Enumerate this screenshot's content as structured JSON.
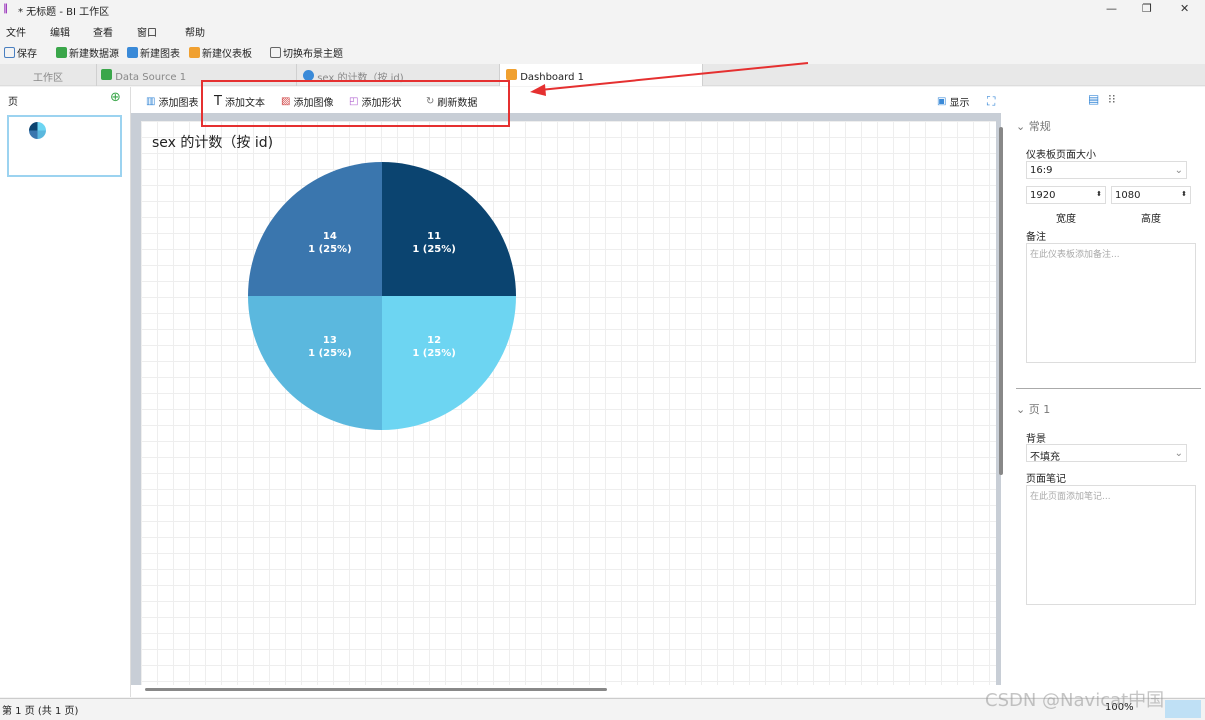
{
  "window": {
    "title": "* 无标题 - BI 工作区",
    "min": "—",
    "max": "❐",
    "close": "✕"
  },
  "menu": [
    "文件",
    "编辑",
    "查看",
    "窗口",
    "帮助"
  ],
  "toolbar": {
    "save": "保存",
    "new_datasource": "新建数据源",
    "new_chart": "新建图表",
    "new_dashboard": "新建仪表板",
    "switch_theme": "切换布景主题"
  },
  "tabs": [
    {
      "label": "工作区"
    },
    {
      "label": "Data Source 1"
    },
    {
      "label": "sex 的计数（按 id)"
    },
    {
      "label": "Dashboard 1"
    }
  ],
  "left": {
    "title": "页",
    "add": "⊕",
    "page_number": "1"
  },
  "dashboard_toolbar": {
    "add_chart": "添加图表",
    "add_text": "添加文本",
    "add_image": "添加图像",
    "add_shape": "添加形状",
    "refresh": "刷新数据",
    "present": "显示"
  },
  "chart_data": {
    "type": "pie",
    "title": "sex 的计数（按 id)",
    "slices": [
      {
        "label": "14",
        "value": 1,
        "percent": "1 (25%)",
        "color": "#0b4470"
      },
      {
        "label": "11",
        "value": 1,
        "percent": "1 (25%)",
        "color": "#6dd5f2"
      },
      {
        "label": "12",
        "value": 1,
        "percent": "1 (25%)",
        "color": "#5bb8de"
      },
      {
        "label": "13",
        "value": 1,
        "percent": "1 (25%)",
        "color": "#3a76ae"
      }
    ]
  },
  "right": {
    "general": "常规",
    "size_label": "仪表板页面大小",
    "size_value": "16:9",
    "width": "1920",
    "height": "1080",
    "width_label": "宽度",
    "height_label": "高度",
    "notes_label": "备注",
    "notes_placeholder": "在此仪表板添加备注...",
    "page_section": "页 1",
    "bg_label": "背景",
    "bg_value": "不填充",
    "page_notes_label": "页面笔记",
    "page_notes_placeholder": "在此页面添加笔记..."
  },
  "status": {
    "pages": "第 1 页 (共 1 页)",
    "zoom": "100%"
  },
  "watermark": "CSDN @Navicat中国"
}
